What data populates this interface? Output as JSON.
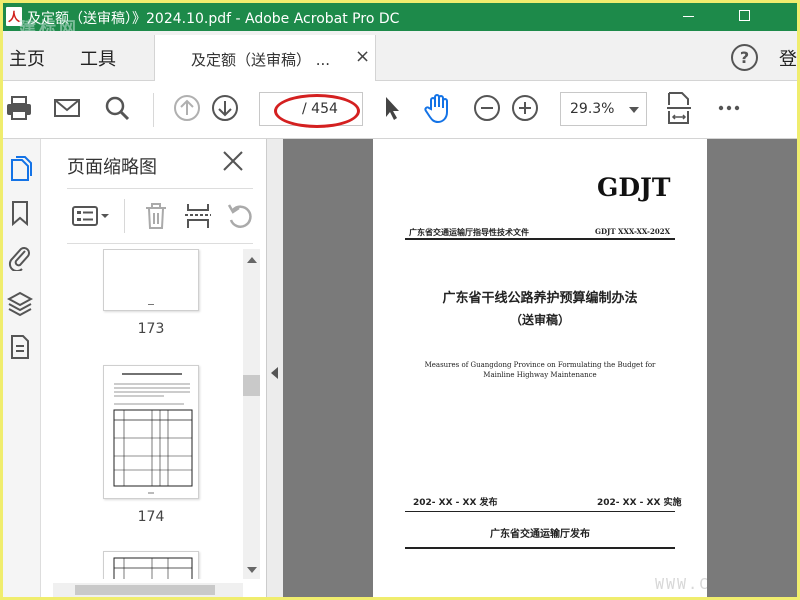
{
  "window": {
    "title": "及定额（送审稿）》2024.10.pdf - Adobe Acrobat Pro DC",
    "watermark_text": "建标网"
  },
  "tabs": {
    "home": "主页",
    "tools": "工具",
    "doc_tab": "及定额（送审稿） ...",
    "doc_close": "×",
    "help": "?",
    "login": "登"
  },
  "toolbar": {
    "page_current": "",
    "page_total": "/ 454",
    "zoom": "29.3%",
    "icons": [
      "print-icon",
      "email-icon",
      "search-icon",
      "prev-page-icon",
      "next-page-icon",
      "select-cursor-icon",
      "hand-icon",
      "zoom-out-icon",
      "zoom-in-icon",
      "page-fit-icon",
      "more-icon"
    ]
  },
  "panel": {
    "title": "页面缩略图",
    "thumbs": [
      {
        "label": "173"
      },
      {
        "label": "174"
      }
    ]
  },
  "document": {
    "logo": "GDJT",
    "header_left": "广东省交通运输厅指导性技术文件",
    "header_right": "GDJT XXX-XX-202X",
    "title": "广东省干线公路养护预算编制办法",
    "subtitle": "（送审稿）",
    "english_1": "Measures of Guangdong  Province on Formulating the Budget  for",
    "english_2": "Mainline Highway Maintenance",
    "pub_left": "202- XX - XX 发布",
    "pub_right": "202- XX - XX 实施",
    "issuer": "广东省交通运输厅发布"
  },
  "overlay": {
    "site_watermark": "WWW.C"
  },
  "colors": {
    "titlebar": "#1d8a4a",
    "accent_blue": "#1473e6",
    "highlight_oval": "#d42020",
    "border_yellow": "#f0ed6e"
  }
}
